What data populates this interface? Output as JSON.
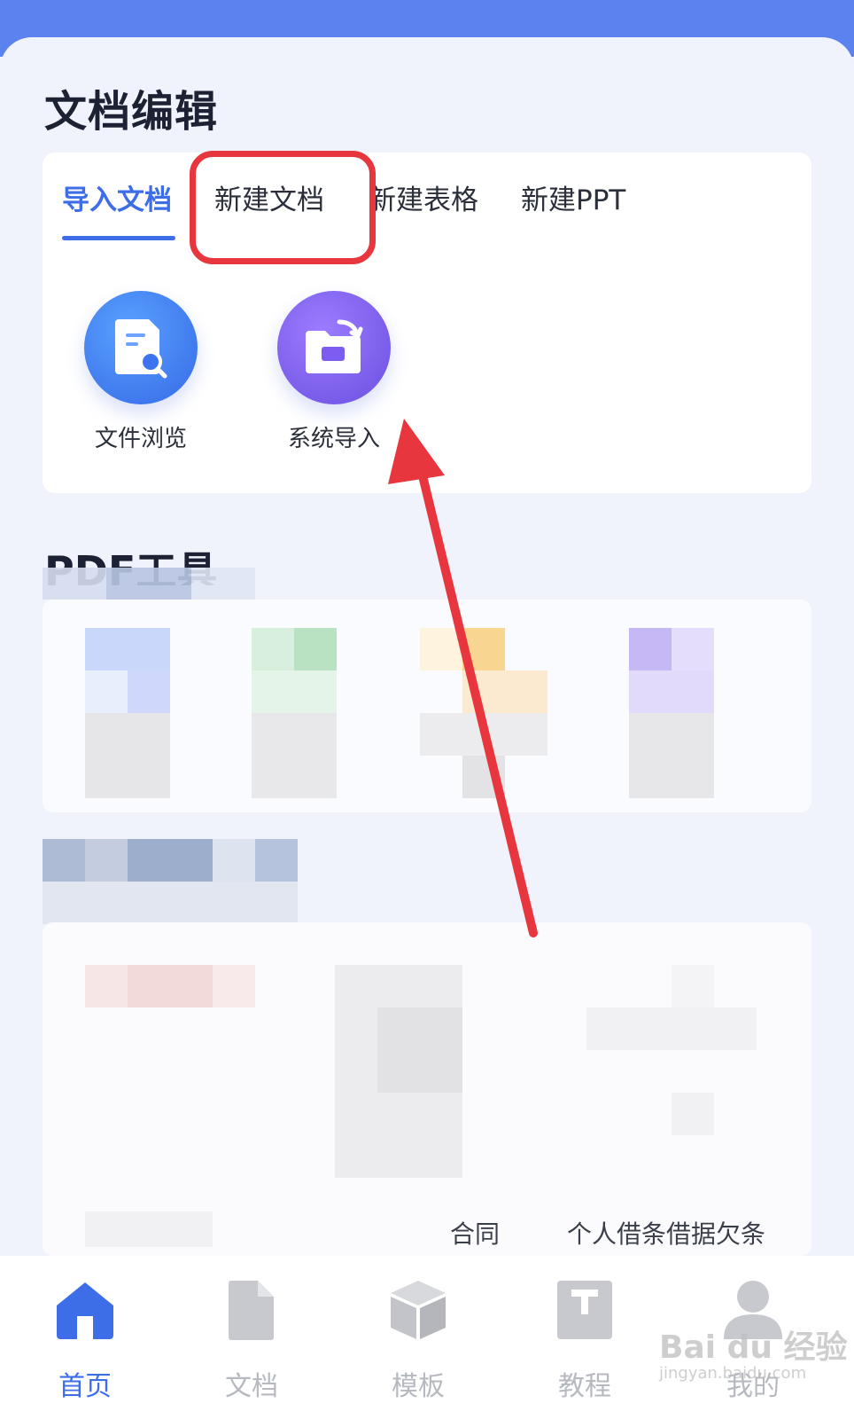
{
  "section": {
    "title": "文档编辑"
  },
  "tabs": [
    {
      "label": "导入文档",
      "active": true
    },
    {
      "label": "新建文档",
      "active": false
    },
    {
      "label": "新建表格",
      "active": false
    },
    {
      "label": "新建PPT",
      "active": false
    }
  ],
  "tools": [
    {
      "label": "文件浏览",
      "icon": "document-search-icon",
      "color": "#3f82ee"
    },
    {
      "label": "系统导入",
      "icon": "folder-import-icon",
      "color": "#7a5cf0"
    }
  ],
  "pdf": {
    "title": "PDF工具"
  },
  "partial_texts": {
    "left": "合同",
    "right": "个人借条借据欠条"
  },
  "nav": [
    {
      "label": "首页",
      "icon": "home-icon",
      "active": true
    },
    {
      "label": "文档",
      "icon": "document-icon",
      "active": false
    },
    {
      "label": "模板",
      "icon": "template-box-icon",
      "active": false
    },
    {
      "label": "教程",
      "icon": "tutorial-book-icon",
      "active": false
    },
    {
      "label": "我的",
      "icon": "profile-icon",
      "active": false
    }
  ],
  "watermark": {
    "brand": "Bai du 经验",
    "url": "jingyan.baidu.com"
  },
  "colors": {
    "accent": "#3d6ee8",
    "annotation": "#e8363f"
  }
}
